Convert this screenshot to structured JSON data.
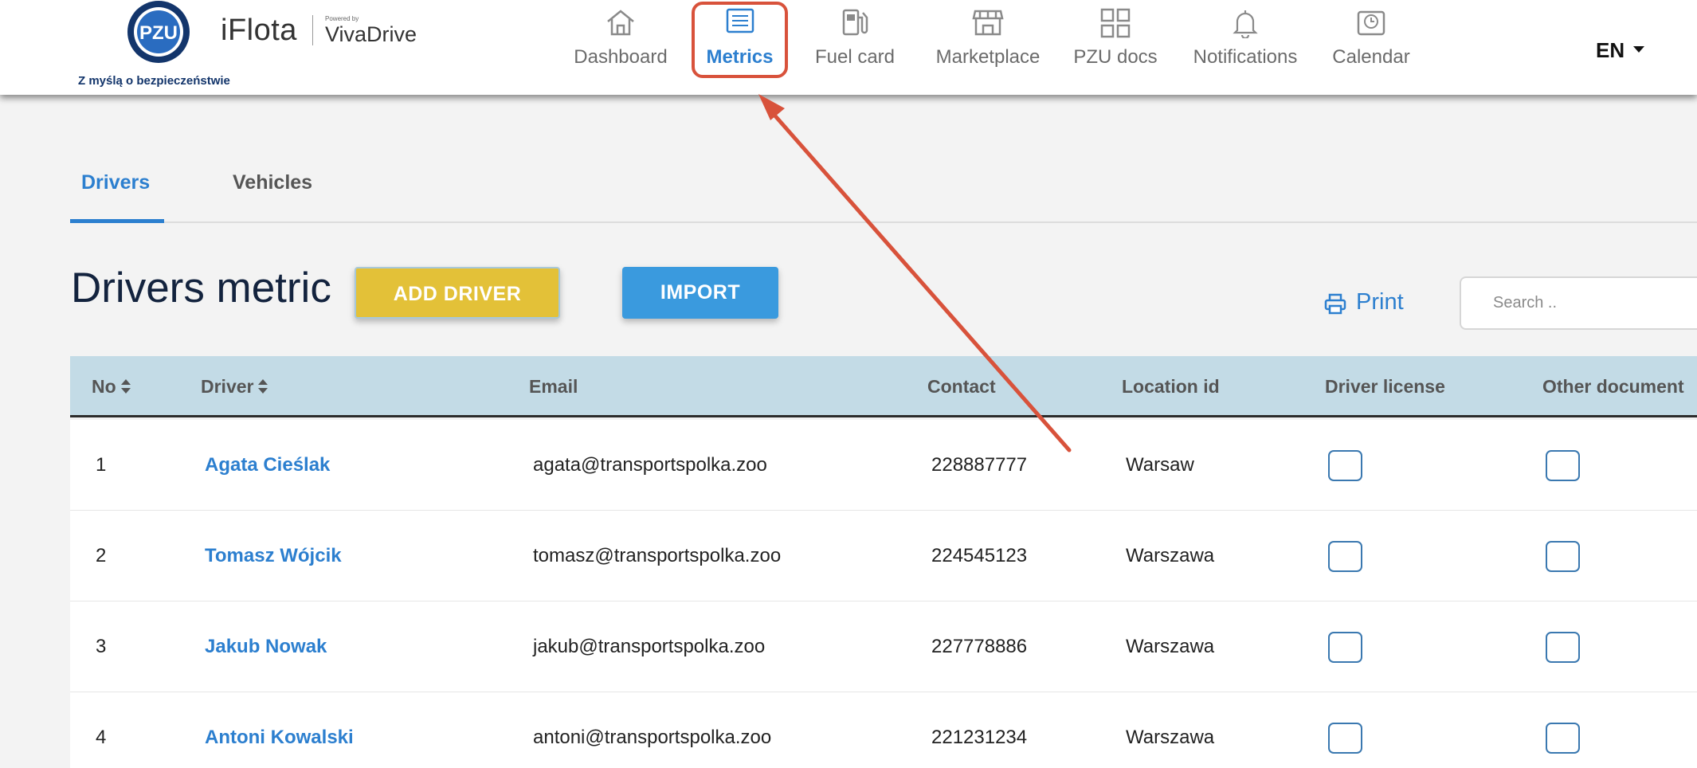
{
  "brand": {
    "logo_text": "PZU",
    "tagline": "Z myślą o bezpieczeństwie",
    "app_name": "iFlota",
    "powered_by": "Powered by",
    "partner": "VivaDrive"
  },
  "nav": {
    "items": [
      {
        "label": "Dashboard",
        "icon": "home-icon"
      },
      {
        "label": "Metrics",
        "icon": "list-icon"
      },
      {
        "label": "Fuel card",
        "icon": "fuel-pump-icon"
      },
      {
        "label": "Marketplace",
        "icon": "store-icon"
      },
      {
        "label": "PZU docs",
        "icon": "grid-icon"
      },
      {
        "label": "Notifications",
        "icon": "bell-icon"
      },
      {
        "label": "Calendar",
        "icon": "calendar-icon"
      }
    ],
    "active": "Metrics",
    "language": "EN"
  },
  "tabs": [
    {
      "label": "Drivers"
    },
    {
      "label": "Vehicles"
    }
  ],
  "page": {
    "title": "Drivers metric",
    "add_label": "ADD DRIVER",
    "import_label": "IMPORT",
    "print_label": "Print",
    "search_placeholder": "Search .."
  },
  "table": {
    "columns": [
      "No",
      "Driver",
      "Email",
      "Contact",
      "Location id",
      "Driver license",
      "Other document"
    ],
    "rows": [
      {
        "no": "1",
        "driver": "Agata Cieślak",
        "email": "agata@transportspolka.zoo",
        "contact": "228887777",
        "location": "Warsaw"
      },
      {
        "no": "2",
        "driver": "Tomasz Wójcik",
        "email": "tomasz@transportspolka.zoo",
        "contact": "224545123",
        "location": "Warszawa"
      },
      {
        "no": "3",
        "driver": "Jakub Nowak",
        "email": "jakub@transportspolka.zoo",
        "contact": "227778886",
        "location": "Warszawa"
      },
      {
        "no": "4",
        "driver": "Antoni Kowalski",
        "email": "antoni@transportspolka.zoo",
        "contact": "221231234",
        "location": "Warszawa"
      }
    ]
  },
  "colors": {
    "accent_blue": "#2c7fcf",
    "add_yellow": "#e3c138",
    "import_blue": "#3a9ade",
    "header_row": "#c3dbe6",
    "annotation_red": "#d8523b"
  }
}
